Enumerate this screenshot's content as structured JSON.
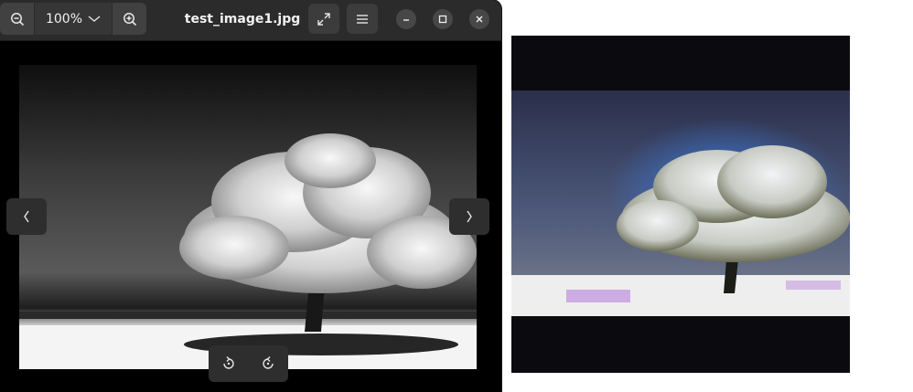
{
  "window": {
    "title": "test_image1.jpg",
    "zoom": {
      "level": "100%",
      "zoom_out_icon": "zoom-out-icon",
      "zoom_in_icon": "zoom-in-icon",
      "dropdown_icon": "chevron-down-icon"
    },
    "header_buttons": [
      "fullscreen-icon",
      "menu-icon"
    ],
    "window_controls": [
      "minimize-icon",
      "maximize-icon",
      "close-icon"
    ]
  },
  "viewer": {
    "image_alt": "black and white photo of a blossoming tree on a beach",
    "nav_prev_icon": "chevron-left-icon",
    "nav_next_icon": "chevron-right-icon",
    "rotate_left_icon": "rotate-left-icon",
    "rotate_right_icon": "rotate-right-icon"
  },
  "preview": {
    "image_alt": "colorized version of the tree photo with blue sky"
  },
  "colors": {
    "headerbar": "#2b2b2b",
    "button": "#3c3c3c",
    "viewer_bg": "#000000",
    "page_bg": "#ffffff"
  }
}
